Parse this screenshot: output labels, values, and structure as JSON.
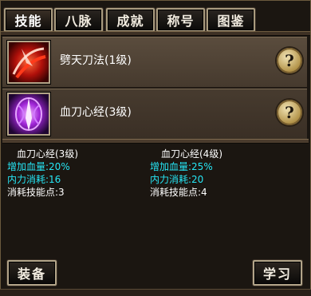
{
  "tabs": [
    {
      "label": "技能"
    },
    {
      "label": "八脉"
    },
    {
      "label": "成就"
    },
    {
      "label": "称号"
    },
    {
      "label": "图鉴"
    }
  ],
  "skills": [
    {
      "name": "劈天刀法(1级)",
      "icon": "red-slash-icon",
      "help": "?"
    },
    {
      "name": "血刀心经(3级)",
      "icon": "purple-blade-icon",
      "help": "?"
    }
  ],
  "info": {
    "current": {
      "title": "血刀心经(3级)",
      "hp_bonus": "增加血量:20%",
      "mp_cost": "内力消耗:16",
      "points": "消耗技能点:3"
    },
    "next": {
      "title": "血刀心经(4级)",
      "hp_bonus": "增加血量:25%",
      "mp_cost": "内力消耗:20",
      "points": "消耗技能点:4"
    }
  },
  "buttons": {
    "equip": "装备",
    "learn": "学习"
  },
  "colors": {
    "accent_cyan": "#26e6f5",
    "panel_brown": "#5a4c3d"
  }
}
